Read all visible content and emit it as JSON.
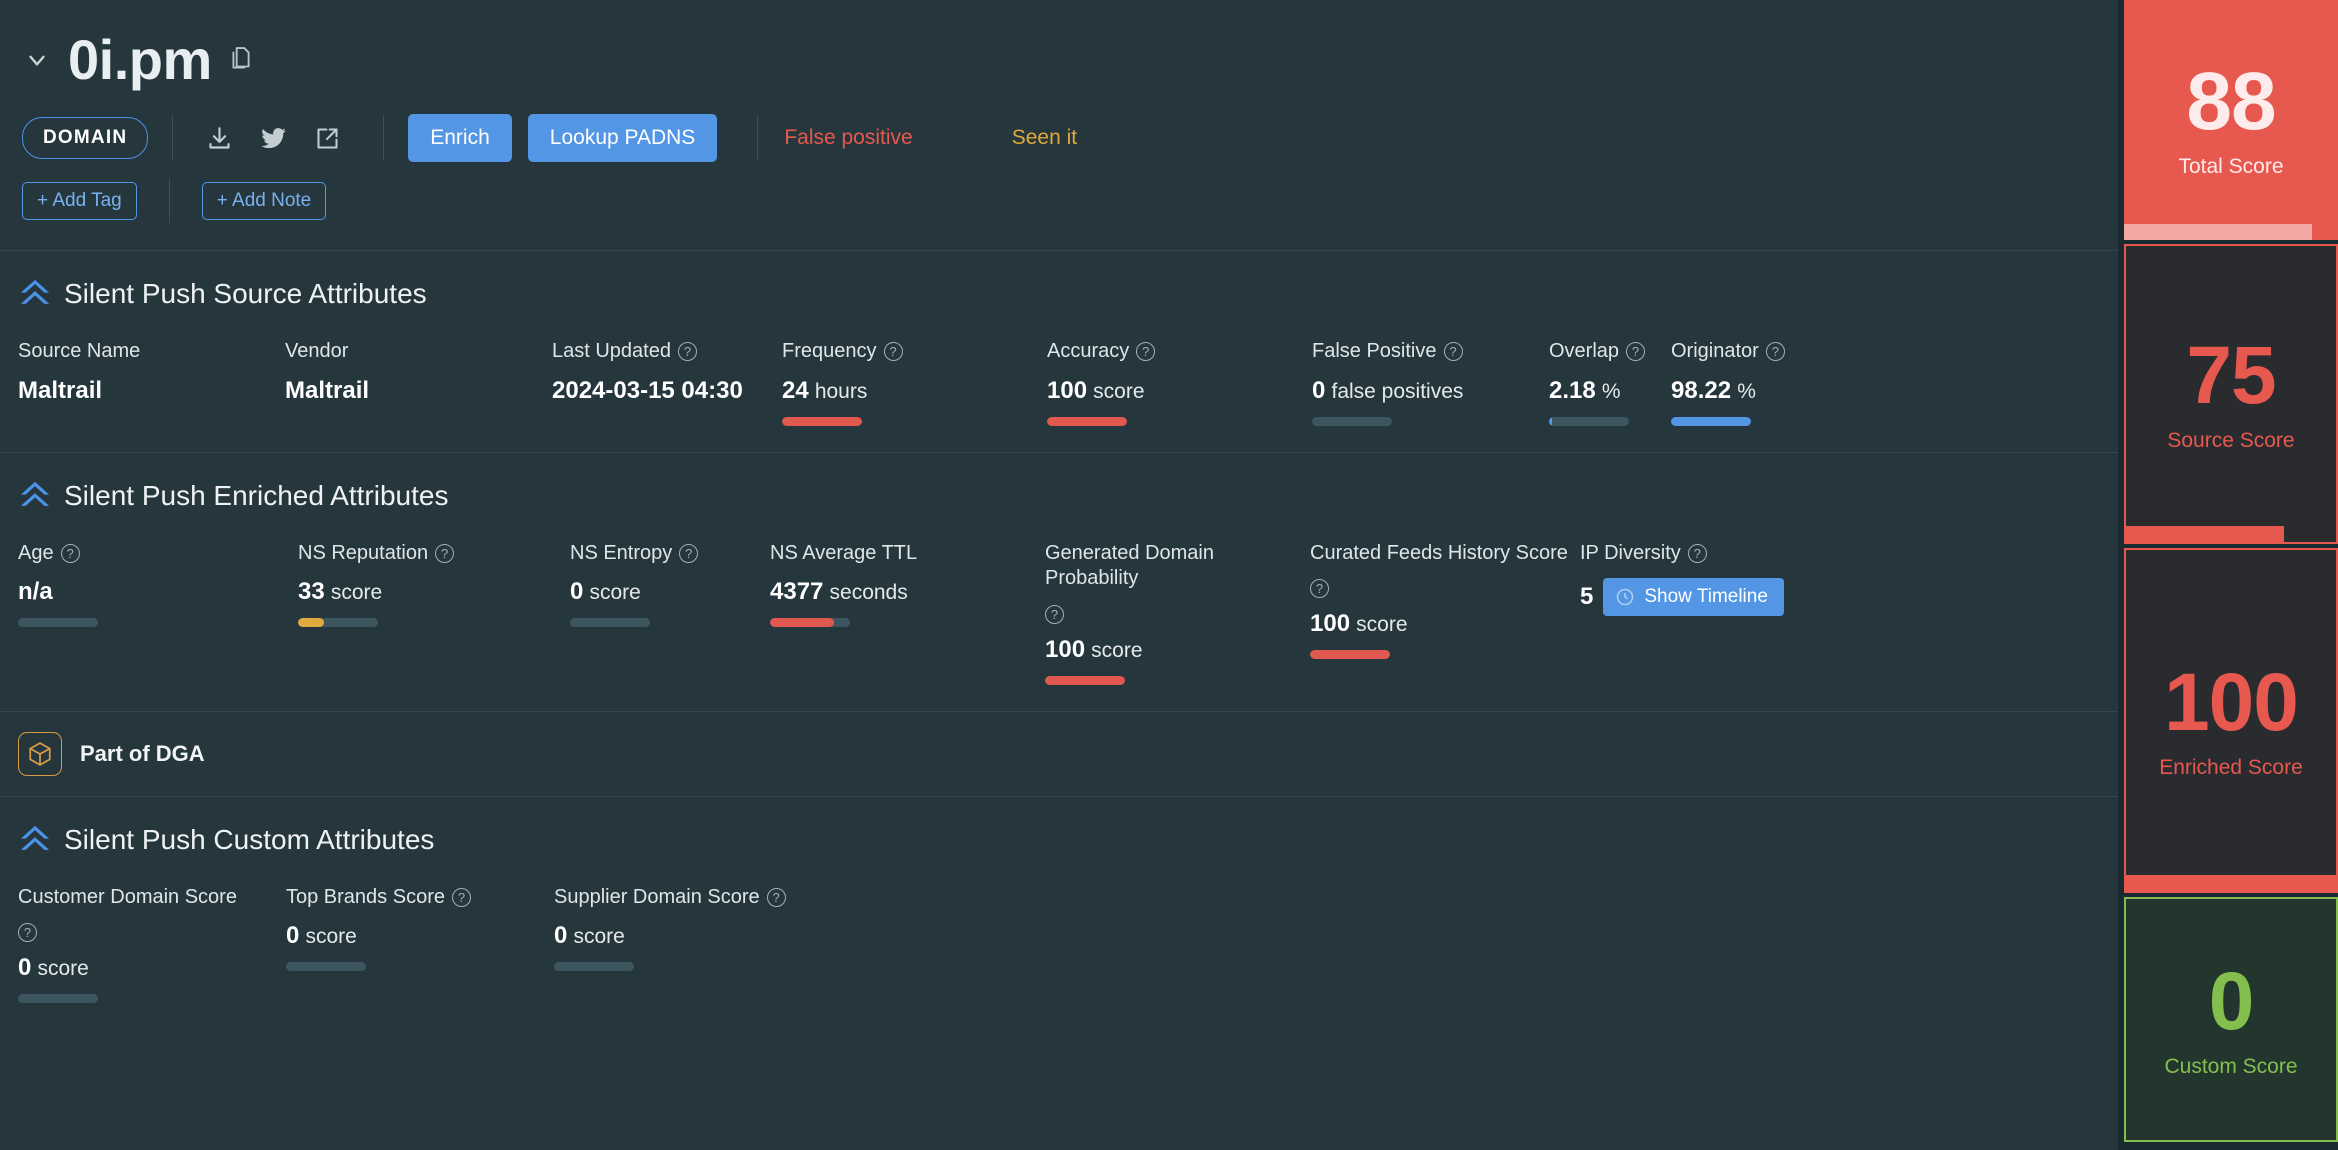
{
  "header": {
    "chevron_icon": "chevron-down-icon",
    "title": "0i.pm",
    "copy_icon": "copy-document-icon",
    "type_badge": "DOMAIN",
    "icons": [
      {
        "name": "download-icon"
      },
      {
        "name": "twitter-icon"
      },
      {
        "name": "external-link-icon"
      }
    ],
    "enrich_label": "Enrich",
    "lookup_label": "Lookup PADNS",
    "false_positive_label": "False positive",
    "seen_it_label": "Seen it",
    "add_tag_label": "+ Add Tag",
    "add_note_label": "+ Add Note"
  },
  "source_section": {
    "title": "Silent Push Source Attributes",
    "logo_icon": "silent-push-chevrons-icon",
    "attributes": [
      {
        "label": "Source Name",
        "help": false,
        "value": "Maltrail",
        "unit": "",
        "bar": false,
        "width": 0,
        "pad": 0
      },
      {
        "label": "Vendor",
        "help": false,
        "value": "Maltrail",
        "unit": "",
        "bar": false,
        "width": 0,
        "pad": 0
      },
      {
        "label": "Last Updated",
        "help": true,
        "value": "2024-03-15 04:30",
        "unit": "",
        "bar": false,
        "width": 0,
        "pad": 0
      },
      {
        "label": "Frequency",
        "help": true,
        "value": "24",
        "unit": "hours",
        "bar": true,
        "fill": 100,
        "color": "#e0584f"
      },
      {
        "label": "Accuracy",
        "help": true,
        "value": "100",
        "unit": "score",
        "bar": true,
        "fill": 100,
        "color": "#e0584f"
      },
      {
        "label": "False Positive",
        "help": true,
        "value": "0",
        "unit": "false positives",
        "bar": true,
        "fill": 0,
        "color": "#3c555f"
      },
      {
        "label": "Overlap",
        "help": true,
        "value": "2.18",
        "unit": "%",
        "bar": true,
        "fill": 4,
        "color": "#5296e5"
      },
      {
        "label": "Originator",
        "help": true,
        "value": "98.22",
        "unit": "%",
        "bar": true,
        "fill": 100,
        "color": "#5296e5"
      }
    ]
  },
  "enriched_section": {
    "title": "Silent Push Enriched Attributes",
    "logo_icon": "silent-push-chevrons-icon",
    "attributes": [
      {
        "label": "Age",
        "help": true,
        "value": "n/a",
        "unit": "",
        "bar": true,
        "fill": 0,
        "color": "#3c555f"
      },
      {
        "label": "NS Reputation",
        "help": true,
        "value": "33",
        "unit": "score",
        "bar": true,
        "fill": 33,
        "color": "#e0aa3e"
      },
      {
        "label": "NS Entropy",
        "help": true,
        "value": "0",
        "unit": "score",
        "bar": true,
        "fill": 0,
        "color": "#3c555f"
      },
      {
        "label": "NS Average TTL",
        "help": false,
        "value": "4377",
        "unit": "seconds",
        "bar": true,
        "fill": 80,
        "color": "#e0584f"
      },
      {
        "label": "Generated Domain Probability",
        "help": true,
        "helpBlock": true,
        "value": "100",
        "unit": "score",
        "bar": true,
        "fill": 100,
        "color": "#e0584f"
      },
      {
        "label": "Curated Feeds History Score",
        "help": true,
        "helpBlock": true,
        "value": "100",
        "unit": "score",
        "bar": true,
        "fill": 100,
        "color": "#e0584f"
      }
    ],
    "ip_diversity": {
      "label": "IP Diversity",
      "value": "5",
      "timeline_button": "Show Timeline",
      "clock_icon": "clock-icon"
    }
  },
  "dga": {
    "icon": "cube-package-icon",
    "label": "Part of DGA"
  },
  "custom_section": {
    "title": "Silent Push Custom Attributes",
    "logo_icon": "silent-push-chevrons-icon",
    "attributes": [
      {
        "label": "Customer Domain Score",
        "help": true,
        "helpBlock": true,
        "value": "0",
        "unit": "score",
        "bar": true,
        "fill": 0,
        "color": "#3c555f"
      },
      {
        "label": "Top Brands Score",
        "help": true,
        "value": "0",
        "unit": "score",
        "bar": true,
        "fill": 0,
        "color": "#3c555f"
      },
      {
        "label": "Supplier Domain Score",
        "help": true,
        "value": "0",
        "unit": "score",
        "bar": true,
        "fill": 0,
        "color": "#3c555f"
      }
    ]
  },
  "scores": {
    "total": {
      "value": "88",
      "label": "Total Score",
      "fill_pct": 88,
      "color": "#e7584f"
    },
    "source": {
      "value": "75",
      "label": "Source Score",
      "fill_pct": 75,
      "color": "#e7584f"
    },
    "enriched": {
      "value": "100",
      "label": "Enriched Score",
      "fill_pct": 100,
      "color": "#e7584f"
    },
    "custom": {
      "value": "0",
      "label": "Custom Score",
      "fill_pct": 0,
      "color": "#84bf4e"
    }
  }
}
